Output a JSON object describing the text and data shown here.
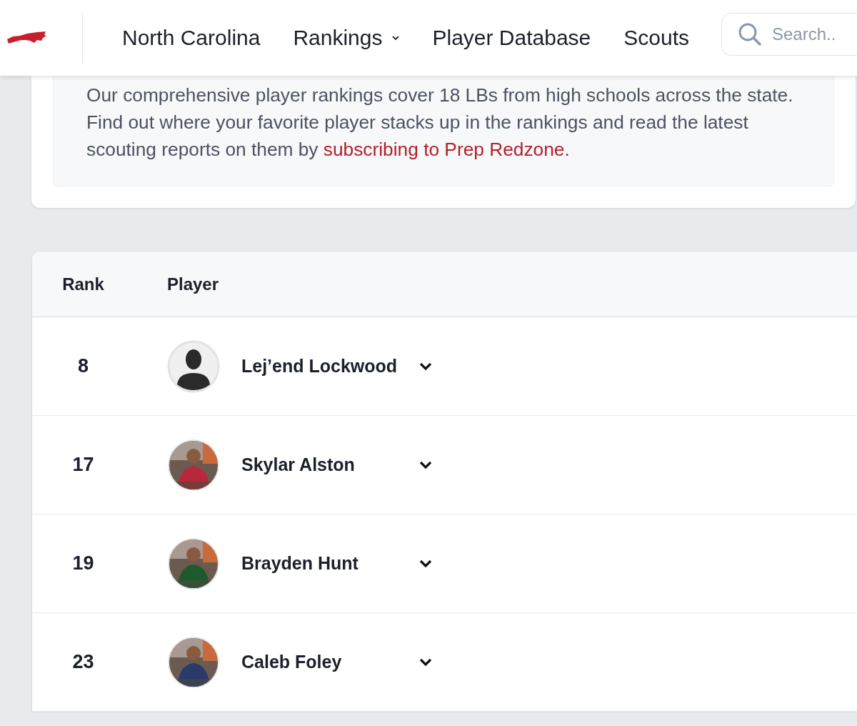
{
  "nav": {
    "items": [
      {
        "label": "North Carolina",
        "dropdown": false
      },
      {
        "label": "Rankings",
        "dropdown": true
      },
      {
        "label": "Player Database",
        "dropdown": false
      },
      {
        "label": "Scouts",
        "dropdown": false
      }
    ],
    "search": {
      "placeholder": "Search.."
    }
  },
  "intro": {
    "text": "Our comprehensive player rankings cover 18 LBs from high schools across the state. Find out where your favorite player stacks up in the rankings and read the latest scouting reports on them by",
    "link": "subscribing to Prep Redzone."
  },
  "table": {
    "columns": [
      "Rank",
      "Player"
    ],
    "rows": [
      {
        "rank": "8",
        "name": "Lej’end Lockwood",
        "avatar": {
          "kind": "placeholder"
        }
      },
      {
        "rank": "17",
        "name": "Skylar Alston"
      },
      {
        "rank": "19",
        "name": "Brayden Hunt"
      },
      {
        "rank": "23",
        "name": "Caleb Foley"
      }
    ]
  }
}
